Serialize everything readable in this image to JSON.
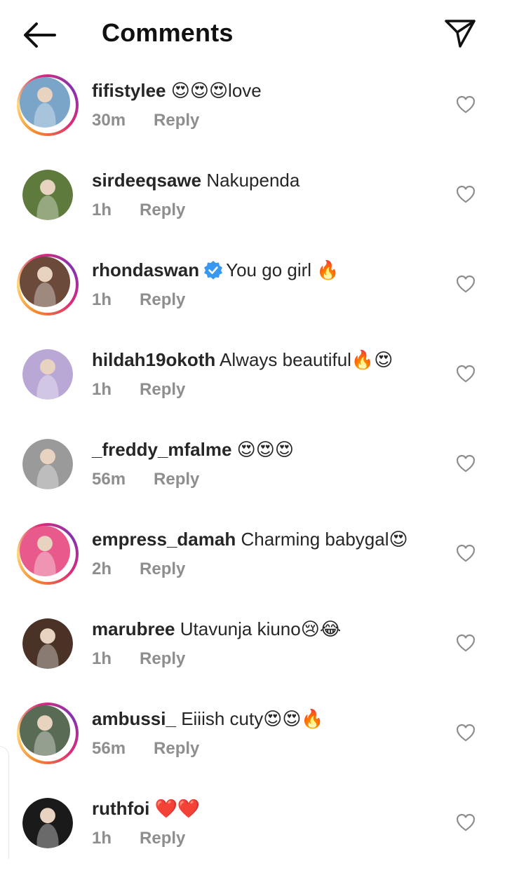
{
  "header": {
    "title": "Comments",
    "back_icon": "arrow-left-icon",
    "share_icon": "paper-plane-icon"
  },
  "comments": [
    {
      "username": "fifistylee",
      "text": "😍😍😍love",
      "time": "30m",
      "reply": "Reply",
      "verified": false,
      "story_ring": true,
      "avatar_color": "#7aa5c9"
    },
    {
      "username": "sirdeeqsawe",
      "text": "Nakupenda",
      "time": "1h",
      "reply": "Reply",
      "verified": false,
      "story_ring": false,
      "avatar_color": "#5e7a3c"
    },
    {
      "username": "rhondaswan",
      "text": "You go girl 🔥",
      "time": "1h",
      "reply": "Reply",
      "verified": true,
      "story_ring": true,
      "avatar_color": "#6b4a3a"
    },
    {
      "username": "hildah19okoth",
      "text": "Always beautiful🔥😍",
      "time": "1h",
      "reply": "Reply",
      "verified": false,
      "story_ring": false,
      "avatar_color": "#b9a7d6"
    },
    {
      "username": "_freddy_mfalme",
      "text": "😍😍😍",
      "time": "56m",
      "reply": "Reply",
      "verified": false,
      "story_ring": false,
      "avatar_color": "#9a9a9a"
    },
    {
      "username": "empress_damah",
      "text": "Charming babygal😍",
      "time": "2h",
      "reply": "Reply",
      "verified": false,
      "story_ring": true,
      "avatar_color": "#e85a8c"
    },
    {
      "username": "marubree",
      "text": "Utavunja kiuno😢😂",
      "time": "1h",
      "reply": "Reply",
      "verified": false,
      "story_ring": false,
      "avatar_color": "#4a3326"
    },
    {
      "username": "ambussi_",
      "text": "Eiiish cuty😍😍🔥",
      "time": "56m",
      "reply": "Reply",
      "verified": false,
      "story_ring": true,
      "avatar_color": "#5a6b55"
    },
    {
      "username": "ruthfoi",
      "text": "❤️❤️",
      "time": "1h",
      "reply": "Reply",
      "verified": false,
      "story_ring": false,
      "avatar_color": "#1a1a1a"
    }
  ],
  "colors": {
    "text_primary": "#262626",
    "text_secondary": "#8e8e8e",
    "verified_blue": "#3897f0",
    "story_gradient": [
      "#f58529",
      "#dd2a7b",
      "#8134af"
    ]
  }
}
